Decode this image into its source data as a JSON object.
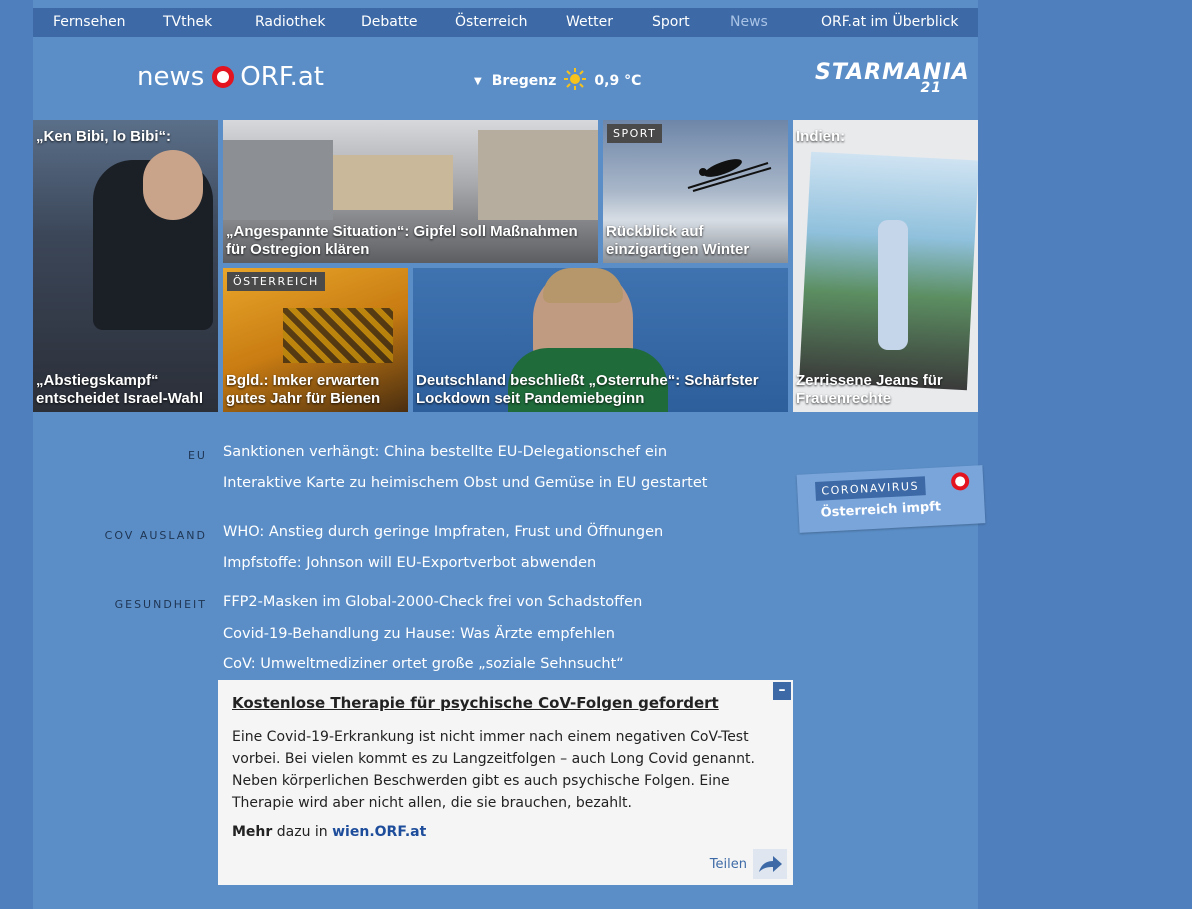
{
  "topnav": {
    "items": [
      "Fernsehen",
      "TVthek",
      "Radiothek",
      "Debatte",
      "Österreich",
      "Wetter",
      "Sport",
      "News",
      "ORF.at im Überblick"
    ]
  },
  "header": {
    "logo_news": "news",
    "logo_orf": "ORF.at",
    "weather_city": "Bregenz",
    "weather_temp": "0,9 °C",
    "starmania": "STARMANIA",
    "starmania_num": "21"
  },
  "tiles": {
    "t1_top": "„Ken Bibi, lo Bibi“:",
    "t1_caption": "„Abstiegskampf“ entscheidet Israel-Wahl",
    "t2_caption": "„Angespannte Situation“: Gipfel soll Maßnahmen für Ostregion klären",
    "t3_tag": "SPORT",
    "t3_caption": "Rückblick auf einzigartigen Winter",
    "t4_top": "Indien:",
    "t4_caption": "Zerrissene Jeans für Frauenrechte",
    "t5_tag": "ÖSTERREICH",
    "t5_caption": "Bgld.: Imker erwarten gutes Jahr für Bienen",
    "t6_caption": "Deutschland beschließt „Osterruhe“: Schärfster Lockdown seit Pandemiebeginn"
  },
  "news": {
    "cat_eu": "EU",
    "cat_cov": "COV AUSLAND",
    "cat_ges": "GESUNDHEIT",
    "items": [
      "Sanktionen verhängt: China bestellte EU-Delegationschef ein",
      "Interaktive Karte zu heimischem Obst und Gemüse in EU gestartet",
      "WHO: Anstieg durch geringe Impfraten, Frust und Öffnungen",
      "Impfstoffe: Johnson will EU-Exportverbot abwenden",
      "FFP2-Masken im Global-2000-Check frei von Schadstoffen",
      "Covid-19-Behandlung zu Hause: Was Ärzte empfehlen",
      "CoV: Umweltmediziner ortet große „soziale Sehnsucht“"
    ]
  },
  "corona": {
    "label": "CORONAVIRUS",
    "sub": "Österreich impft"
  },
  "popup": {
    "close": "–",
    "title": "Kostenlose Therapie für psychische CoV-Folgen gefordert",
    "body": "Eine Covid-19-Erkrankung ist nicht immer nach einem negativen CoV-Test vorbei. Bei vielen kommt es zu Langzeitfolgen – auch Long Covid genannt. Neben körperlichen Beschwerden gibt es auch psychische Folgen. Eine Therapie wird aber nicht allen, die sie brauchen, bezahlt.",
    "more_bold": "Mehr",
    "more_text": "dazu in",
    "more_link": "wien.ORF.at",
    "share": "Teilen"
  }
}
